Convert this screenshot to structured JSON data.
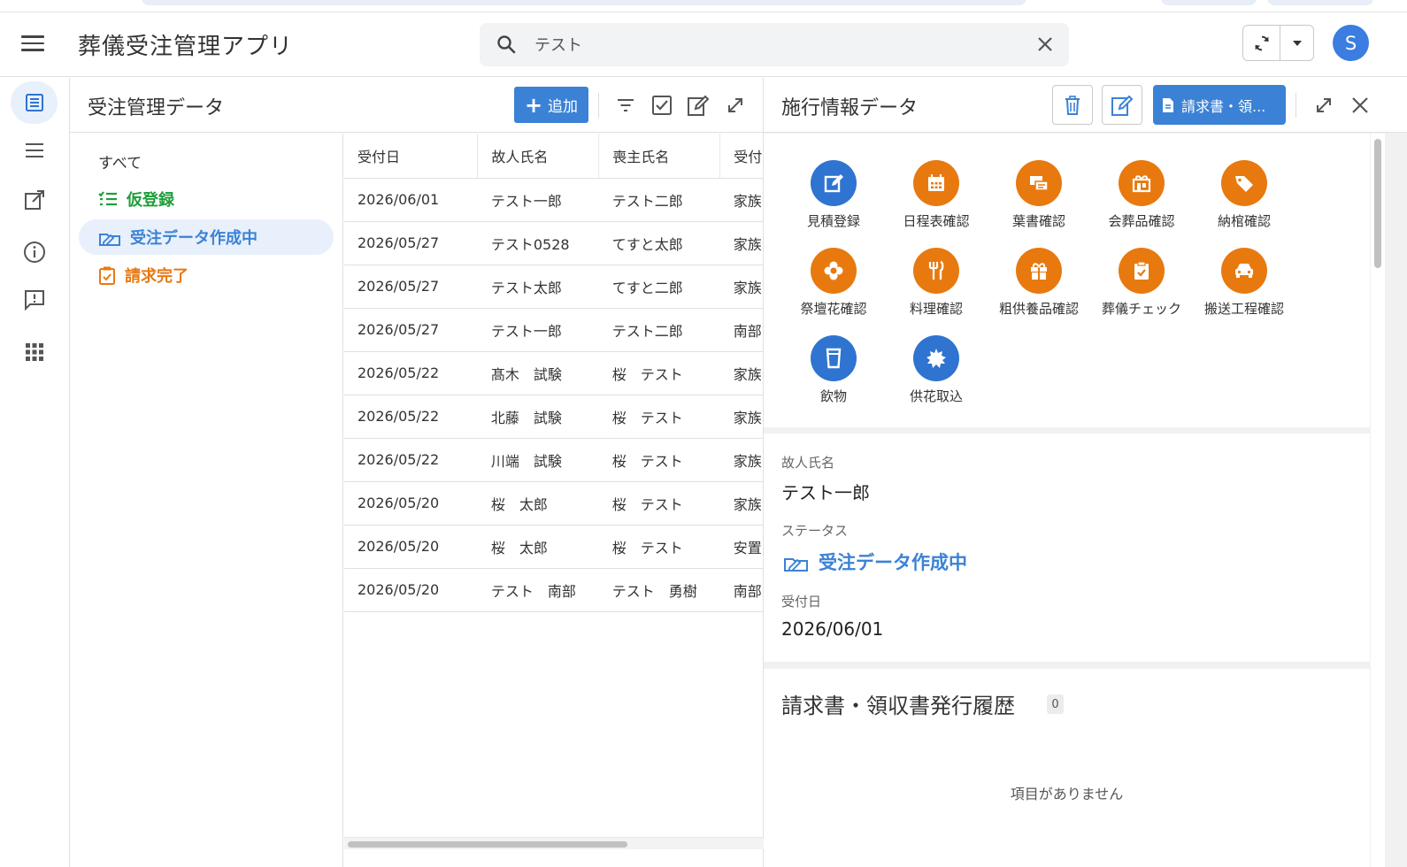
{
  "header": {
    "app_title": "葬儀受注管理アプリ",
    "search_value": "テスト",
    "avatar_initial": "S"
  },
  "list_panel": {
    "title": "受注管理データ",
    "add_label": "追加",
    "filters": [
      {
        "label": "すべて",
        "color": "#333333",
        "icon": "none"
      },
      {
        "label": "仮登録",
        "color": "#1e9e3a",
        "icon": "checklist-icon"
      },
      {
        "label": "受注データ作成中",
        "color": "#3b82d6",
        "icon": "draft-icon",
        "active": true
      },
      {
        "label": "請求完了",
        "color": "#e8790f",
        "icon": "clipboard-check-icon"
      }
    ],
    "columns": [
      "受付日",
      "故人氏名",
      "喪主氏名",
      "受付"
    ],
    "rows": [
      [
        "2026/06/01",
        "テスト一郎",
        "テスト二郎",
        "家族"
      ],
      [
        "2026/05/27",
        "テスト0528",
        "てすと太郎",
        "家族"
      ],
      [
        "2026/05/27",
        "テスト太郎",
        "てすと二郎",
        "家族"
      ],
      [
        "2026/05/27",
        "テスト一郎",
        "テスト二郎",
        "南部"
      ],
      [
        "2026/05/22",
        "髙木　試験",
        "桜　テスト",
        "家族"
      ],
      [
        "2026/05/22",
        "北藤　試験",
        "桜　テスト",
        "家族"
      ],
      [
        "2026/05/22",
        "川端　試験",
        "桜　テスト",
        "家族"
      ],
      [
        "2026/05/20",
        "桜　太郎",
        "桜　テスト",
        "家族"
      ],
      [
        "2026/05/20",
        "桜　太郎",
        "桜　テスト",
        "安置"
      ],
      [
        "2026/05/20",
        "テスト　南部",
        "テスト　勇樹",
        "南部"
      ]
    ]
  },
  "detail_panel": {
    "title": "施行情報データ",
    "invoice_button_label": "請求書・領...",
    "actions": [
      {
        "label": "見積登録",
        "color": "blue",
        "icon": "edit-icon"
      },
      {
        "label": "日程表確認",
        "color": "orange",
        "icon": "calendar-icon"
      },
      {
        "label": "葉書確認",
        "color": "orange",
        "icon": "postcard-icon"
      },
      {
        "label": "会葬品確認",
        "color": "orange",
        "icon": "gift-shop-icon"
      },
      {
        "label": "納棺確認",
        "color": "orange",
        "icon": "tag-icon"
      },
      {
        "label": "祭壇花確認",
        "color": "orange",
        "icon": "flower-icon"
      },
      {
        "label": "料理確認",
        "color": "orange",
        "icon": "utensils-icon"
      },
      {
        "label": "粗供養品確認",
        "color": "orange",
        "icon": "gift-icon"
      },
      {
        "label": "葬儀チェック",
        "color": "orange",
        "icon": "clipboard-check-icon"
      },
      {
        "label": "搬送工程確認",
        "color": "orange",
        "icon": "car-icon"
      },
      {
        "label": "飲物",
        "color": "blue",
        "icon": "cup-icon"
      },
      {
        "label": "供花取込",
        "color": "blue",
        "icon": "leaf-icon"
      }
    ],
    "fields": {
      "deceased_label": "故人氏名",
      "deceased_value": "テスト一郎",
      "status_label": "ステータス",
      "status_value": "受注データ作成中",
      "date_label": "受付日",
      "date_value": "2026/06/01"
    },
    "history": {
      "title": "請求書・領収書発行履歴",
      "count": "0",
      "empty_message": "項目がありません"
    }
  },
  "colors": {
    "accent": "#3b82d6",
    "orange": "#e8790f",
    "green": "#1e9e3a"
  }
}
